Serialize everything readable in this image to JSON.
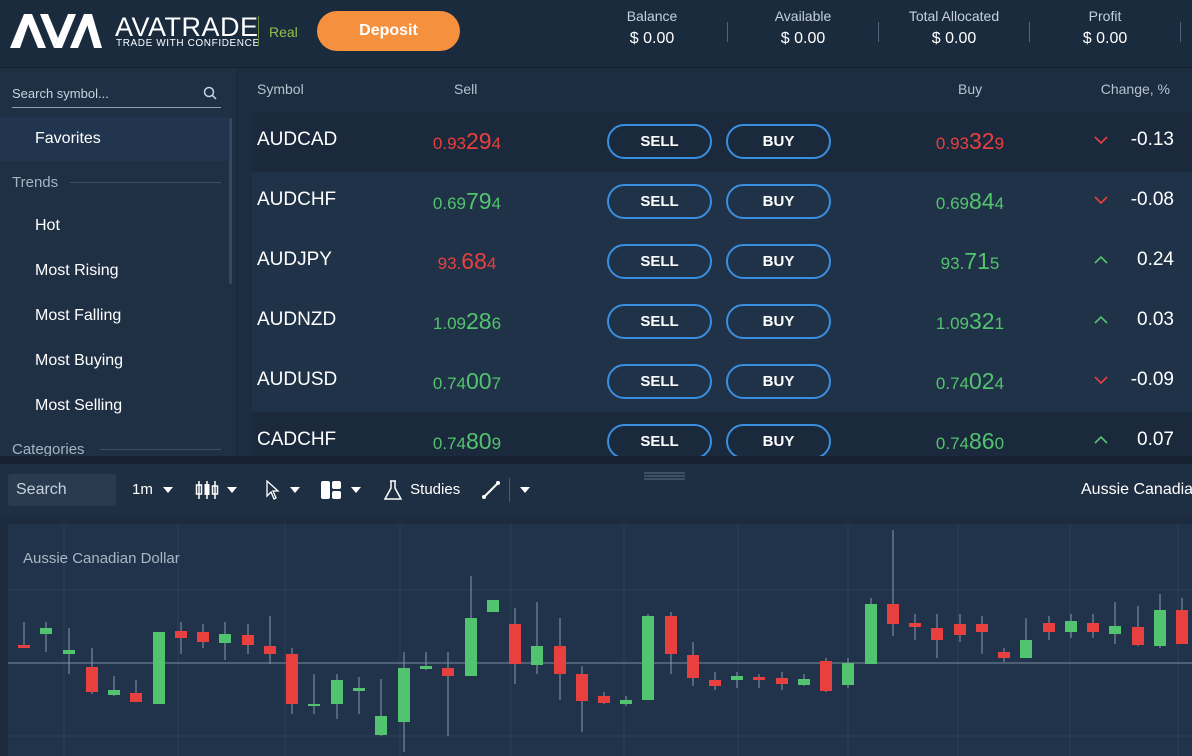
{
  "header": {
    "brand": "AVATRADE",
    "tagline": "TRADE WITH CONFIDENCE",
    "account_mode": "Real",
    "deposit_label": "Deposit",
    "stats": [
      {
        "label": "Balance",
        "value": "$ 0.00"
      },
      {
        "label": "Available",
        "value": "$ 0.00"
      },
      {
        "label": "Total Allocated",
        "value": "$ 0.00"
      },
      {
        "label": "Profit",
        "value": "$ 0.00"
      }
    ]
  },
  "sidebar": {
    "search_placeholder": "Search symbol...",
    "favorites": "Favorites",
    "trends_title": "Trends",
    "trend_items": [
      "Hot",
      "Most Rising",
      "Most Falling",
      "Most Buying",
      "Most Selling"
    ],
    "categories_title": "Categories"
  },
  "table": {
    "columns": {
      "symbol": "Symbol",
      "sell": "Sell",
      "buy": "Buy",
      "change": "Change, %"
    },
    "sell_button": "SELL",
    "buy_button": "BUY",
    "rows": [
      {
        "symbol": "AUDCAD",
        "sell": [
          "0.93",
          "29",
          "4"
        ],
        "sell_color": "red",
        "buy": [
          "0.93",
          "32",
          "9"
        ],
        "buy_color": "red",
        "dir": "down",
        "change": "-0.13"
      },
      {
        "symbol": "AUDCHF",
        "sell": [
          "0.69",
          "79",
          "4"
        ],
        "sell_color": "green",
        "buy": [
          "0.69",
          "84",
          "4"
        ],
        "buy_color": "green",
        "dir": "down",
        "change": "-0.08"
      },
      {
        "symbol": "AUDJPY",
        "sell": [
          "93.",
          "68",
          "4"
        ],
        "sell_color": "red",
        "buy": [
          "93.",
          "71",
          "5"
        ],
        "buy_color": "green",
        "dir": "up",
        "change": "0.24"
      },
      {
        "symbol": "AUDNZD",
        "sell": [
          "1.09",
          "28",
          "6"
        ],
        "sell_color": "green",
        "buy": [
          "1.09",
          "32",
          "1"
        ],
        "buy_color": "green",
        "dir": "up",
        "change": "0.03"
      },
      {
        "symbol": "AUDUSD",
        "sell": [
          "0.74",
          "00",
          "7"
        ],
        "sell_color": "green",
        "buy": [
          "0.74",
          "02",
          "4"
        ],
        "buy_color": "green",
        "dir": "down",
        "change": "-0.09"
      },
      {
        "symbol": "CADCHF",
        "sell": [
          "0.74",
          "80",
          "9"
        ],
        "sell_color": "green",
        "buy": [
          "0.74",
          "86",
          "0"
        ],
        "buy_color": "green",
        "dir": "up",
        "change": "0.07"
      }
    ]
  },
  "chart_toolbar": {
    "search_placeholder": "Search",
    "interval": "1m",
    "studies_label": "Studies",
    "instrument_title": "Aussie Canadian Dollar"
  },
  "chart": {
    "label": "Aussie Canadian Dollar",
    "colors": {
      "up": "#52c36e",
      "down": "#e8403e",
      "grid": "#2a3f57",
      "wick": "#8a9aab"
    }
  }
}
